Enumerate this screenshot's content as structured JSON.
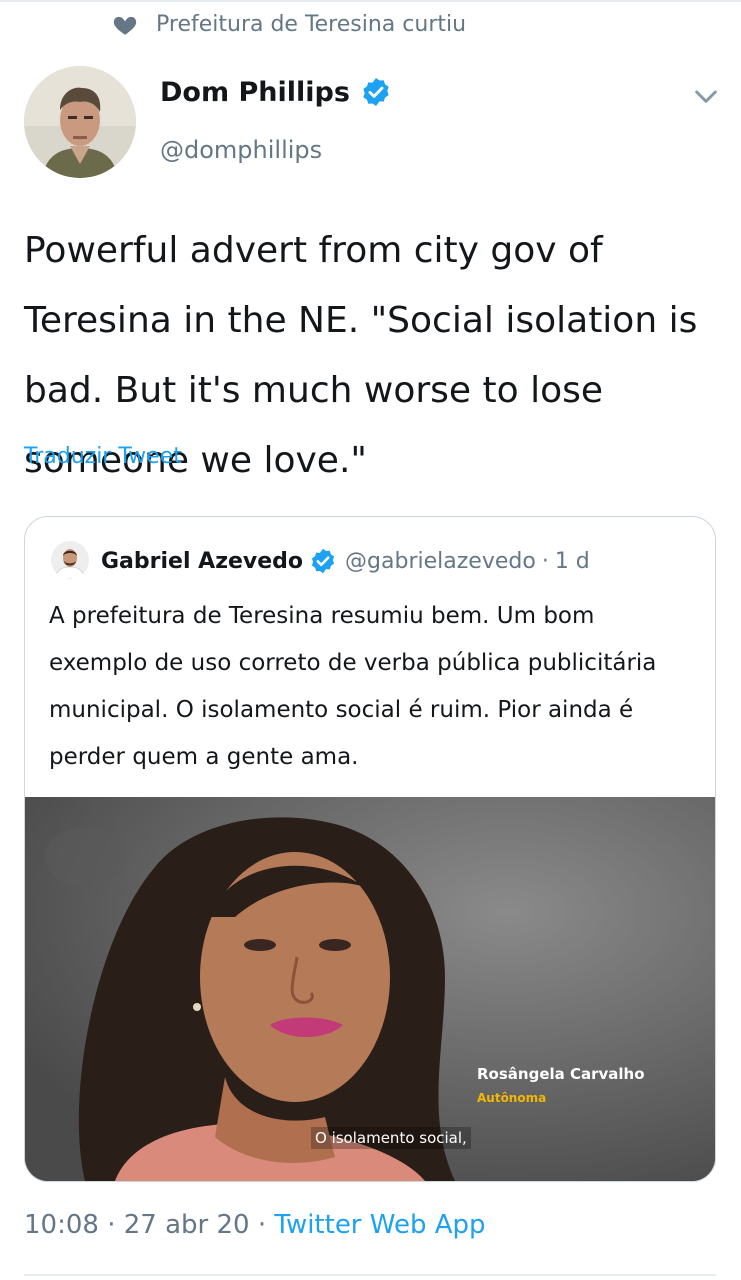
{
  "social_context": {
    "text": "Prefeitura de Teresina curtiu",
    "icon": "heart-icon"
  },
  "author": {
    "name": "Dom Phillips",
    "handle": "@domphillips",
    "verified": true
  },
  "tweet": {
    "text": "Powerful advert from city gov of Teresina in the NE. \"Social isolation is bad. But it's much worse to lose someone we love.\"",
    "translate_label": "Traduzir Tweet"
  },
  "quoted_tweet": {
    "name": "Gabriel Azevedo",
    "handle": "@gabrielazevedo",
    "separator": "·",
    "time": "1 d",
    "text": "A prefeitura de Teresina resumiu bem. Um bom exemplo de uso correto de verba pública publicitária municipal. O isolamento social é ruim. Pior ainda é perder quem a gente ama.",
    "media": {
      "lower_third_name": "Rosângela Carvalho",
      "lower_third_role": "Autônoma",
      "subtitle": "O isolamento social,"
    }
  },
  "footer": {
    "time": "10:08",
    "sep1": "·",
    "date": "27 abr 20",
    "sep2": "·",
    "app": "Twitter Web App"
  },
  "colors": {
    "link": "#1da1f2",
    "secondary_text": "#657786",
    "primary_text": "#14171a",
    "border": "#ccd6dd",
    "role_accent": "#f2b705"
  }
}
